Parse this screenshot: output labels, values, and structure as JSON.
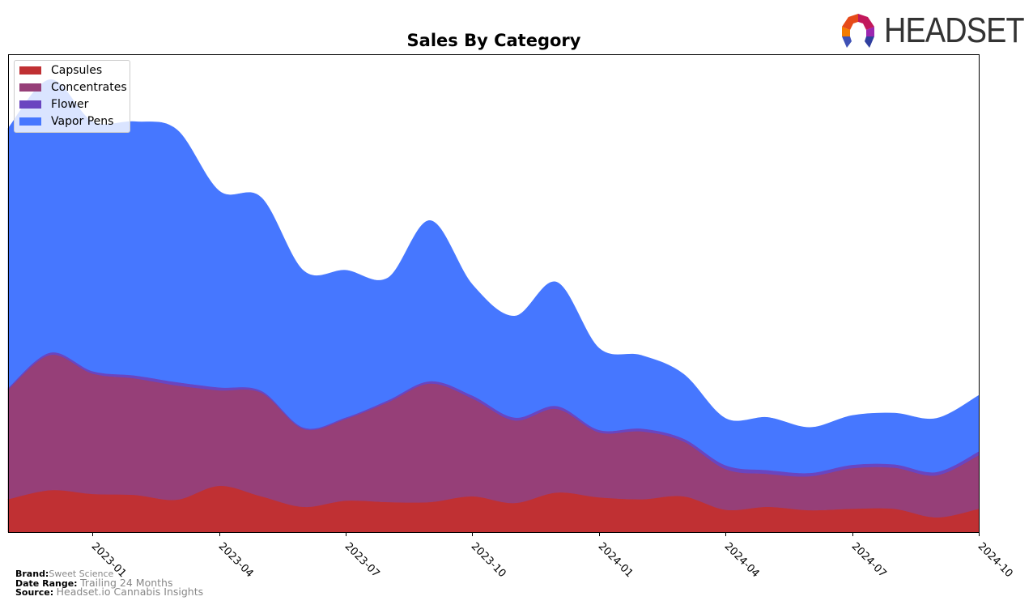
{
  "chart_data": {
    "type": "area",
    "stacked": true,
    "title": "Sales By Category",
    "xlabel": "",
    "ylabel": "",
    "y_ticks_shown": false,
    "ylim": [
      0,
      100
    ],
    "units": "relative (no y-axis shown)",
    "grid": false,
    "legend_position": "top-left",
    "x": [
      "2022-11",
      "2022-12",
      "2023-01",
      "2023-02",
      "2023-03",
      "2023-04",
      "2023-05",
      "2023-06",
      "2023-07",
      "2023-08",
      "2023-09",
      "2023-10",
      "2023-11",
      "2023-12",
      "2024-01",
      "2024-02",
      "2024-03",
      "2024-04",
      "2024-05",
      "2024-06",
      "2024-07",
      "2024-08",
      "2024-09",
      "2024-10"
    ],
    "x_tick_labels": [
      "2023-01",
      "2023-04",
      "2023-07",
      "2023-10",
      "2024-01",
      "2024-04",
      "2024-07",
      "2024-10"
    ],
    "series": [
      {
        "name": "Capsules",
        "color": "#c03033",
        "values": [
          6.9,
          8.8,
          8.0,
          7.8,
          6.8,
          9.7,
          7.5,
          5.3,
          6.6,
          6.3,
          6.3,
          7.5,
          6.1,
          8.3,
          7.3,
          6.9,
          7.5,
          4.7,
          5.3,
          4.6,
          4.9,
          4.9,
          3.1,
          4.9
        ]
      },
      {
        "name": "Concentrates",
        "color": "#963f78",
        "values": [
          23.0,
          28.3,
          25.2,
          24.4,
          23.9,
          20.0,
          21.7,
          16.3,
          17.1,
          20.9,
          24.8,
          20.5,
          17.3,
          17.5,
          13.6,
          14.2,
          11.5,
          8.5,
          6.9,
          7.1,
          8.5,
          8.6,
          8.8,
          11.2
        ]
      },
      {
        "name": "Flower",
        "color": "#6a45c0",
        "values": [
          0.3,
          0.5,
          0.5,
          0.6,
          0.7,
          0.6,
          0.4,
          0.3,
          0.3,
          0.4,
          0.5,
          0.6,
          0.6,
          0.6,
          0.5,
          0.6,
          0.6,
          0.8,
          0.8,
          0.7,
          0.7,
          0.7,
          0.7,
          0.8
        ]
      },
      {
        "name": "Vapor Pens",
        "color": "#4677ff",
        "values": [
          54.3,
          57.1,
          52.2,
          53.1,
          52.8,
          41.1,
          40.4,
          32.8,
          30.8,
          25.6,
          33.6,
          23.2,
          21.2,
          25.9,
          17.1,
          15.3,
          13.5,
          9.8,
          11.0,
          9.5,
          10.3,
          10.7,
          11.2,
          11.7
        ]
      }
    ]
  },
  "legend": {
    "items": [
      {
        "label": "Capsules",
        "color": "#c03033"
      },
      {
        "label": "Concentrates",
        "color": "#963f78"
      },
      {
        "label": "Flower",
        "color": "#6a45c0"
      },
      {
        "label": "Vapor Pens",
        "color": "#4677ff"
      }
    ]
  },
  "logo": {
    "text": "HEADSET"
  },
  "footer": {
    "brand_label": "Brand:",
    "brand_value": "Sweet Science",
    "date_range_label": "Date Range:",
    "date_range_value": "Trailing 24 Months",
    "source_label": "Source:",
    "source_value": "Headset.io Cannabis Insights"
  }
}
